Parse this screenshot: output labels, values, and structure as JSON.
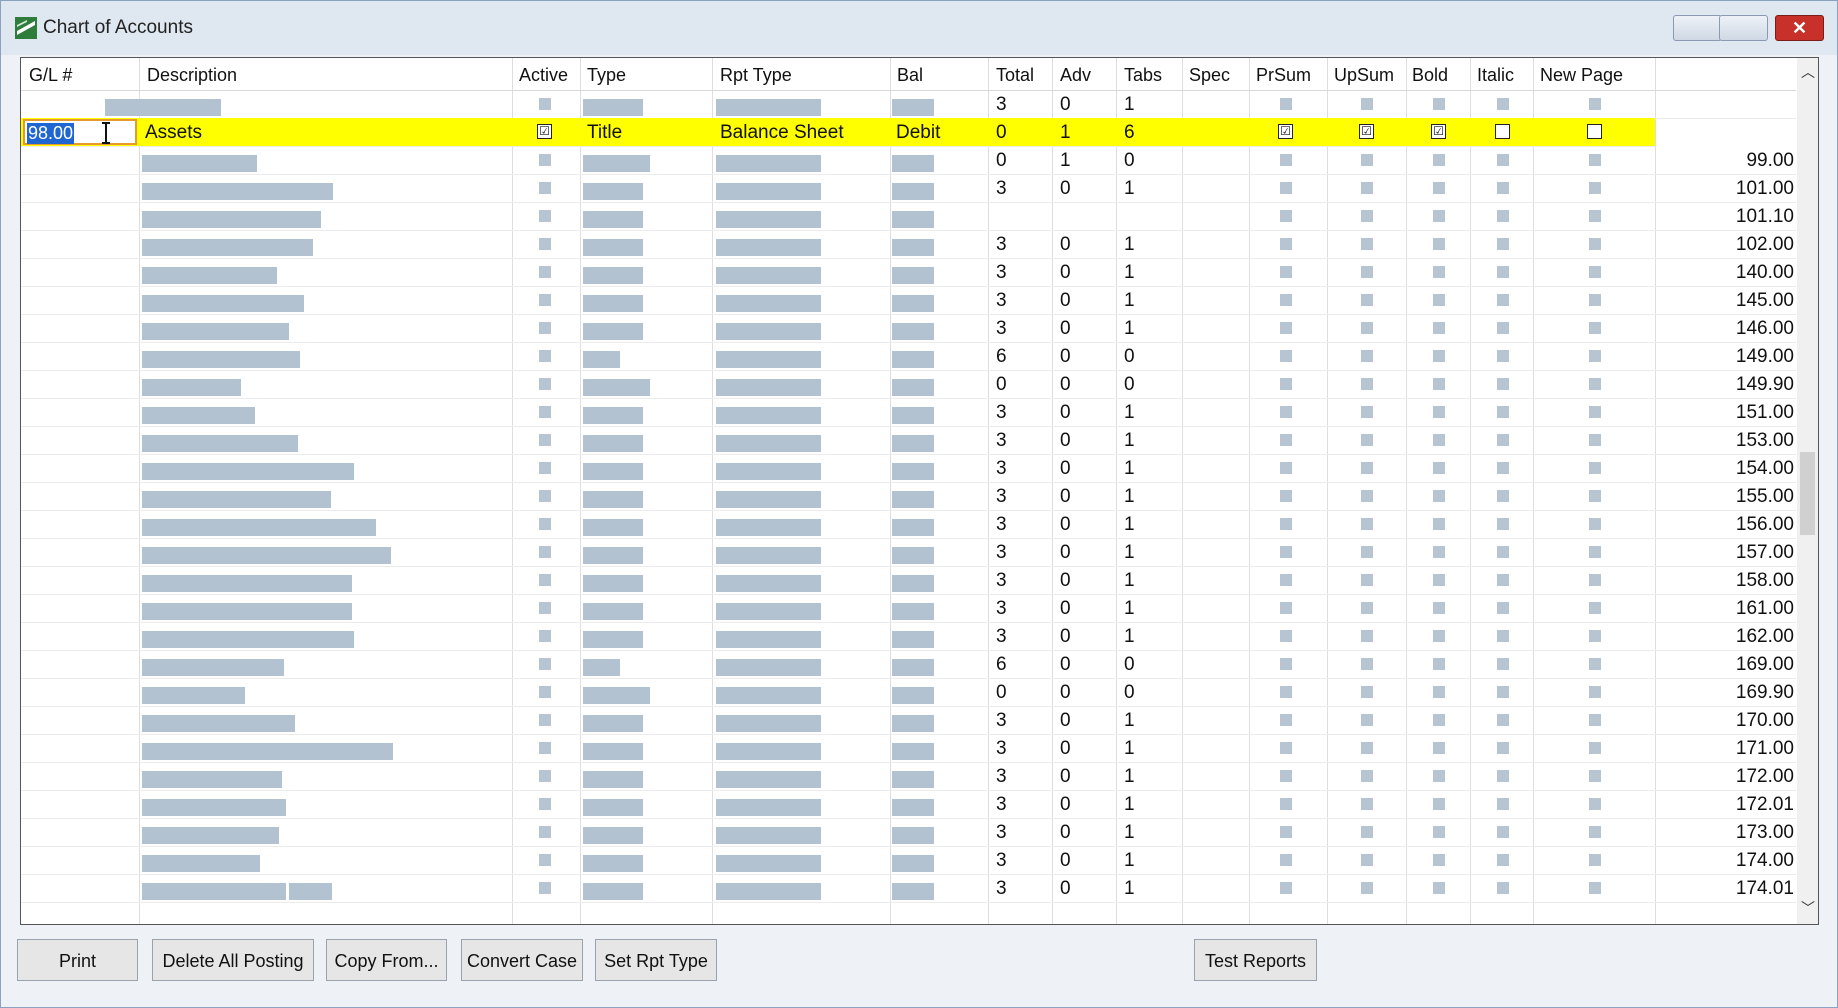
{
  "window": {
    "title": "Chart of Accounts",
    "close_glyph": "✕",
    "icons": {
      "app": "app-icon",
      "minimize": "minimize-icon",
      "maximize": "maximize-icon",
      "close": "close-icon"
    }
  },
  "grid": {
    "columns": [
      "G/L #",
      "Description",
      "Active",
      "Type",
      "Rpt Type",
      "Bal",
      "Total",
      "Adv",
      "Tabs",
      "Spec",
      "PrSum",
      "UpSum",
      "Bold",
      "Italic",
      "New Page"
    ],
    "selected_row": {
      "gl": "98.00",
      "description": "Assets",
      "active": true,
      "type": "Title",
      "rpt_type": "Balance Sheet",
      "bal": "Debit",
      "total": "0",
      "adv": "1",
      "tabs": "6",
      "prsum": true,
      "upsum": true,
      "bold": true,
      "italic": false,
      "new_page": false
    },
    "top_partial_row": {
      "total": "3",
      "adv": "0",
      "tabs": "1"
    },
    "rows": [
      {
        "gl": "99.00",
        "total": "0",
        "adv": "1",
        "tabs": "0"
      },
      {
        "gl": "101.00",
        "total": "3",
        "adv": "0",
        "tabs": "1"
      },
      {
        "gl": "101.10",
        "total": "",
        "adv": "",
        "tabs": ""
      },
      {
        "gl": "102.00",
        "total": "3",
        "adv": "0",
        "tabs": "1"
      },
      {
        "gl": "140.00",
        "total": "3",
        "adv": "0",
        "tabs": "1"
      },
      {
        "gl": "145.00",
        "total": "3",
        "adv": "0",
        "tabs": "1"
      },
      {
        "gl": "146.00",
        "total": "3",
        "adv": "0",
        "tabs": "1"
      },
      {
        "gl": "149.00",
        "total": "6",
        "adv": "0",
        "tabs": "0"
      },
      {
        "gl": "149.90",
        "total": "0",
        "adv": "0",
        "tabs": "0"
      },
      {
        "gl": "151.00",
        "total": "3",
        "adv": "0",
        "tabs": "1"
      },
      {
        "gl": "153.00",
        "total": "3",
        "adv": "0",
        "tabs": "1"
      },
      {
        "gl": "154.00",
        "total": "3",
        "adv": "0",
        "tabs": "1"
      },
      {
        "gl": "155.00",
        "total": "3",
        "adv": "0",
        "tabs": "1"
      },
      {
        "gl": "156.00",
        "total": "3",
        "adv": "0",
        "tabs": "1"
      },
      {
        "gl": "157.00",
        "total": "3",
        "adv": "0",
        "tabs": "1"
      },
      {
        "gl": "158.00",
        "total": "3",
        "adv": "0",
        "tabs": "1"
      },
      {
        "gl": "161.00",
        "total": "3",
        "adv": "0",
        "tabs": "1"
      },
      {
        "gl": "162.00",
        "total": "3",
        "adv": "0",
        "tabs": "1"
      },
      {
        "gl": "169.00",
        "total": "6",
        "adv": "0",
        "tabs": "0"
      },
      {
        "gl": "169.90",
        "total": "0",
        "adv": "0",
        "tabs": "0"
      },
      {
        "gl": "170.00",
        "total": "3",
        "adv": "0",
        "tabs": "1"
      },
      {
        "gl": "171.00",
        "total": "3",
        "adv": "0",
        "tabs": "1"
      },
      {
        "gl": "172.00",
        "total": "3",
        "adv": "0",
        "tabs": "1"
      },
      {
        "gl": "172.01",
        "total": "3",
        "adv": "0",
        "tabs": "1"
      },
      {
        "gl": "173.00",
        "total": "3",
        "adv": "0",
        "tabs": "1"
      },
      {
        "gl": "174.00",
        "total": "3",
        "adv": "0",
        "tabs": "1"
      },
      {
        "gl": "174.01",
        "total": "3",
        "adv": "0",
        "tabs": "1"
      }
    ],
    "scroll": {
      "up_glyph": "︿",
      "down_glyph": "﹀"
    }
  },
  "buttons": {
    "print": "Print",
    "delete_all_posting": "Delete All Posting",
    "copy_from": "Copy From...",
    "convert_case": "Convert Case",
    "set_rpt_type": "Set Rpt Type",
    "test_reports": "Test Reports"
  },
  "colors": {
    "selected_row": "#ffff00",
    "redaction": "#b2c2d0",
    "edit_border": "#e69a2e",
    "selection_highlight": "#1f66d1"
  }
}
